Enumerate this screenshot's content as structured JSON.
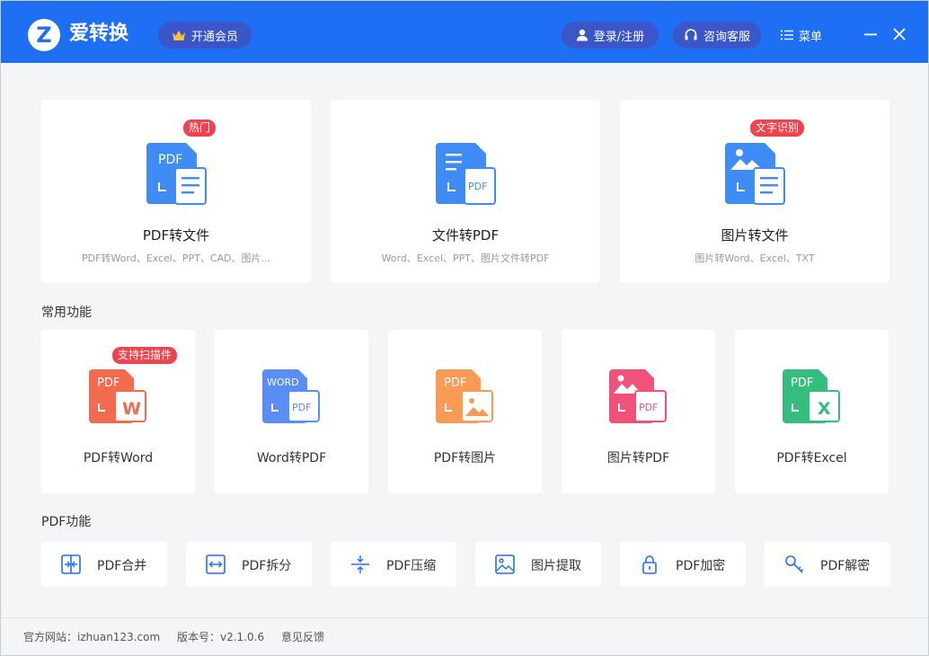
{
  "app": {
    "logo_letter": "Z",
    "title": "爱转换"
  },
  "header": {
    "vip_label": "开通会员",
    "login_label": "登录/注册",
    "service_label": "咨询客服",
    "menu_label": "菜单"
  },
  "top_cards": [
    {
      "title": "PDF转文件",
      "subtitle": "PDF转Word、Excel、PPT、CAD、图片...",
      "badge": "热门"
    },
    {
      "title": "文件转PDF",
      "subtitle": "Word、Excel、PPT、图片文件转PDF",
      "badge": ""
    },
    {
      "title": "图片转文件",
      "subtitle": "图片转Word、Excel、TXT",
      "badge": "文字识别"
    }
  ],
  "common": {
    "title": "常用功能",
    "items": [
      {
        "title": "PDF转Word",
        "badge": "支持扫描件",
        "icon_top": "PDF",
        "icon_bottom": "W",
        "color": "#f26b4f"
      },
      {
        "title": "Word转PDF",
        "badge": "",
        "icon_top": "WORD",
        "icon_bottom": "PDF",
        "color": "#5b8df6"
      },
      {
        "title": "PDF转图片",
        "badge": "",
        "icon_top": "PDF",
        "icon_bottom": "",
        "color": "#fb9a54"
      },
      {
        "title": "图片转PDF",
        "badge": "",
        "icon_top": "",
        "icon_bottom": "PDF",
        "color": "#f2527a"
      },
      {
        "title": "PDF转Excel",
        "badge": "",
        "icon_top": "PDF",
        "icon_bottom": "X",
        "color": "#34bd7c"
      }
    ]
  },
  "pdf_tools": {
    "title": "PDF功能",
    "items": [
      {
        "title": "PDF合并",
        "icon": "merge-icon"
      },
      {
        "title": "PDF拆分",
        "icon": "split-icon"
      },
      {
        "title": "PDF压缩",
        "icon": "compress-icon"
      },
      {
        "title": "图片提取",
        "icon": "image-extract-icon"
      },
      {
        "title": "PDF加密",
        "icon": "lock-icon"
      },
      {
        "title": "PDF解密",
        "icon": "key-icon"
      }
    ]
  },
  "footer": {
    "website": "官方网站：izhuan123.com",
    "version": "版本号：v2.1.0.6",
    "feedback": "意见反馈"
  },
  "colors": {
    "primary": "#1f6ff5",
    "badge": "#f0434e",
    "icon_blue": "#3f8cf6"
  }
}
